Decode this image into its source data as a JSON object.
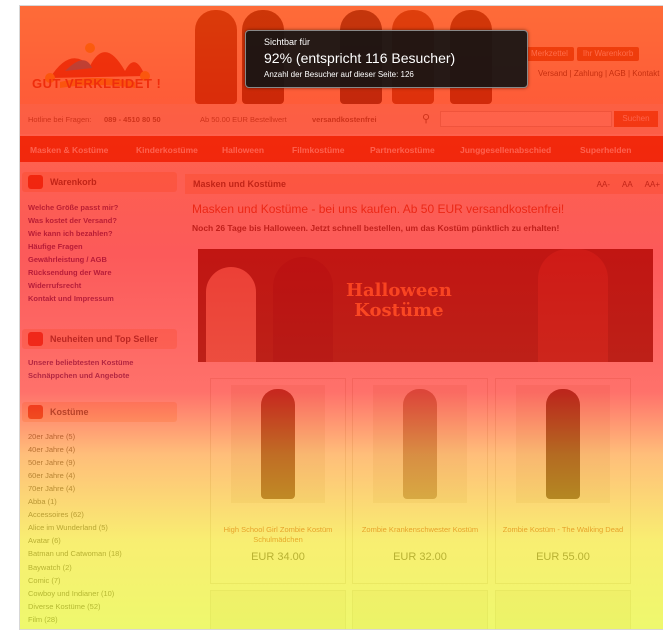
{
  "header": {
    "logo_text": "GUT VERKLEIDET !",
    "buttons": [
      "Merkzettel",
      "Ihr Warenkorb"
    ],
    "links": "Versand | Zahlung | AGB | Kontakt"
  },
  "hotline": {
    "text": "Hotline bei Fragen:",
    "phone": "089 - 4510 80 50",
    "shipping": "Ab 50.00 EUR Bestellwert",
    "free": "versandkostenfrei",
    "search_button": "Suchen"
  },
  "nav": {
    "items": [
      "Masken & Kostüme",
      "Kinderkostüme",
      "Halloween",
      "Filmkostüme",
      "Partnerkostüme",
      "Junggesellenabschied",
      "Superhelden"
    ]
  },
  "sidebar": {
    "cart_title": "Warenkorb",
    "cart_links": [
      "Welche Größe passt mir?",
      "Was kostet der Versand?",
      "Wie kann ich bezahlen?",
      "Häufige Fragen",
      "Gewährleistung / AGB",
      "Rücksendung der Ware",
      "Widerrufsrecht",
      "Kontakt und Impressum"
    ],
    "news_title": "Neuheiten und Top Seller",
    "news_links": [
      "Unsere beliebtesten Kostüme",
      "Schnäppchen und Angebote"
    ],
    "costumes_title": "Kostüme",
    "costume_links": [
      "20er Jahre (5)",
      "40er Jahre (4)",
      "50er Jahre (9)",
      "60er Jahre (4)",
      "70er Jahre (4)",
      "Abba (1)",
      "Accessoires (62)",
      "Alice im Wunderland (5)",
      "Avatar (6)",
      "Batman und Catwoman (18)",
      "Baywatch (2)",
      "Comic (7)",
      "Cowboy und Indianer (10)",
      "Diverse Kostüme (52)",
      "Film (28)"
    ]
  },
  "main": {
    "title": "Masken und Kostüme",
    "font_sizes": [
      "AA-",
      "AA",
      "AA+"
    ],
    "headline": "Masken und Kostüme - bei uns kaufen. Ab 50 EUR versandkostenfrei!",
    "subline": "Noch 26 Tage bis Halloween. Jetzt schnell bestellen, um das Kostüm pünktlich zu erhalten!",
    "banner_line1": "Halloween",
    "banner_line2": "Kostüme",
    "products": [
      {
        "name": "High School Girl Zombie Kostüm Schulmädchen",
        "price": "EUR 34.00"
      },
      {
        "name": "Zombie Krankenschwester Kostüm",
        "price": "EUR 32.00"
      },
      {
        "name": "Zombie Kostüm - The Walking Dead",
        "price": "EUR 55.00"
      }
    ]
  },
  "tooltip": {
    "line1": "Sichtbar für",
    "line2": "92% (entspricht 116 Besucher)",
    "line3": "Anzahl der Besucher auf dieser Seite: 126"
  },
  "colors": {
    "heat_top": "#ff3c00",
    "heat_bottom": "#e6f528",
    "nav": "#d63a1a"
  }
}
